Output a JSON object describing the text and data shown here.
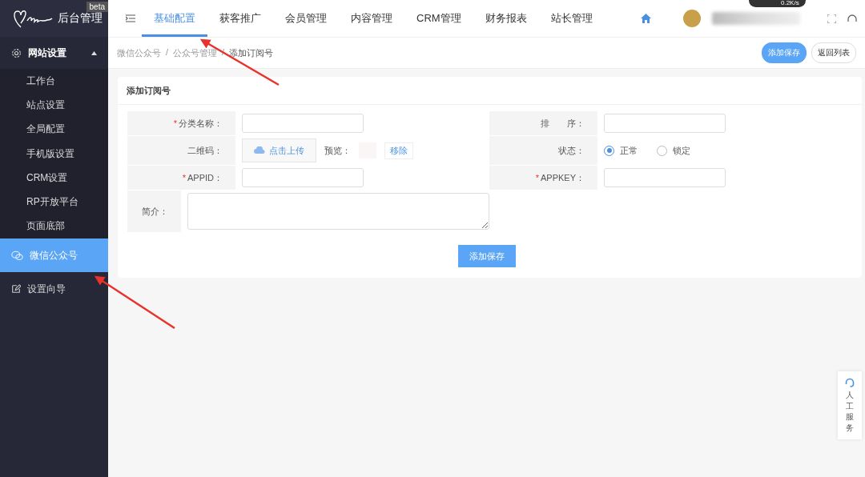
{
  "brand": {
    "title": "后台管理",
    "badge": "beta"
  },
  "sidebar": [
    {
      "label": "网站设置",
      "expanded": true,
      "children": [
        {
          "label": "工作台"
        },
        {
          "label": "站点设置"
        },
        {
          "label": "全局配置"
        },
        {
          "label": "手机版设置"
        },
        {
          "label": "CRM设置"
        },
        {
          "label": "RP开放平台"
        },
        {
          "label": "页面底部"
        }
      ]
    },
    {
      "label": "微信公众号",
      "selected": true
    },
    {
      "label": "设置向导",
      "selected": false
    }
  ],
  "tabs": [
    {
      "label": "基础配置",
      "selected": true
    },
    {
      "label": "获客推广",
      "selected": false
    },
    {
      "label": "会员管理",
      "selected": false
    },
    {
      "label": "内容管理",
      "selected": false
    },
    {
      "label": "CRM管理",
      "selected": false
    },
    {
      "label": "财务报表",
      "selected": false
    },
    {
      "label": "站长管理",
      "selected": false
    }
  ],
  "net_speed": "0.2K/s",
  "breadcrumb": {
    "separator": "/",
    "items": [
      "微信公众号",
      "公众号管理",
      "添加订阅号"
    ]
  },
  "header_buttons": [
    {
      "label": "添加保存",
      "kind": "primary"
    },
    {
      "label": "返回列表",
      "kind": "plain"
    }
  ],
  "card": {
    "title": "添加订阅号",
    "rows": [
      [
        {
          "label": "分类名称：",
          "mark": "*",
          "kind": "input"
        },
        {
          "label": "排　　序：",
          "kind": "input"
        }
      ],
      [
        {
          "label": "二维码：",
          "kind": "upload",
          "button": "点击上传",
          "preview_label": "预览：",
          "remove": "移除"
        },
        {
          "label": "状态：",
          "kind": "radio",
          "options": [
            {
              "label": "正常",
              "selected": true
            },
            {
              "label": "锁定",
              "selected": false
            }
          ]
        }
      ],
      [
        {
          "label": "APPID：",
          "mark": "*",
          "kind": "input"
        },
        {
          "label": "APPKEY：",
          "mark": "*",
          "kind": "input"
        }
      ],
      [
        {
          "label": "简介：",
          "kind": "textarea"
        }
      ]
    ],
    "submit": "添加保存"
  },
  "service": "人工服务"
}
